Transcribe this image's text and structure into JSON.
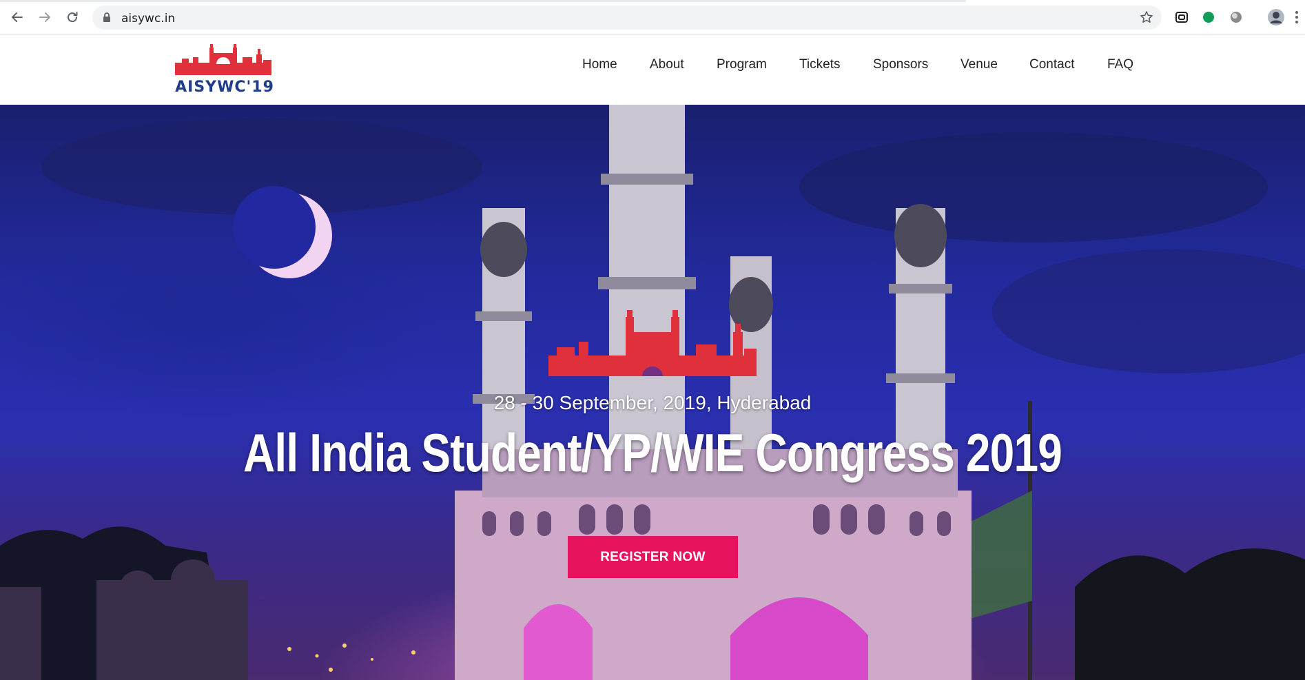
{
  "browser": {
    "url": "aisywc.in",
    "back_icon": "arrow-left-icon",
    "forward_icon": "arrow-right-icon",
    "reload_icon": "reload-icon",
    "lock_icon": "lock-icon",
    "star_icon": "star-icon",
    "menu_icon": "kebab-menu-icon"
  },
  "site": {
    "logo_text": "AISYWC'19",
    "brand_red": "#e0303c",
    "brand_blue": "#1f3c88"
  },
  "nav": {
    "items": [
      {
        "label": "Home"
      },
      {
        "label": "About"
      },
      {
        "label": "Program"
      },
      {
        "label": "Tickets"
      },
      {
        "label": "Sponsors"
      },
      {
        "label": "Venue"
      },
      {
        "label": "Contact"
      },
      {
        "label": "FAQ"
      }
    ]
  },
  "hero": {
    "date_location": "28 - 30 September, 2019, Hyderabad",
    "title": "All India Student/YP/WIE Congress 2019",
    "cta_label": "REGISTER NOW",
    "cta_color": "#e8135f"
  }
}
